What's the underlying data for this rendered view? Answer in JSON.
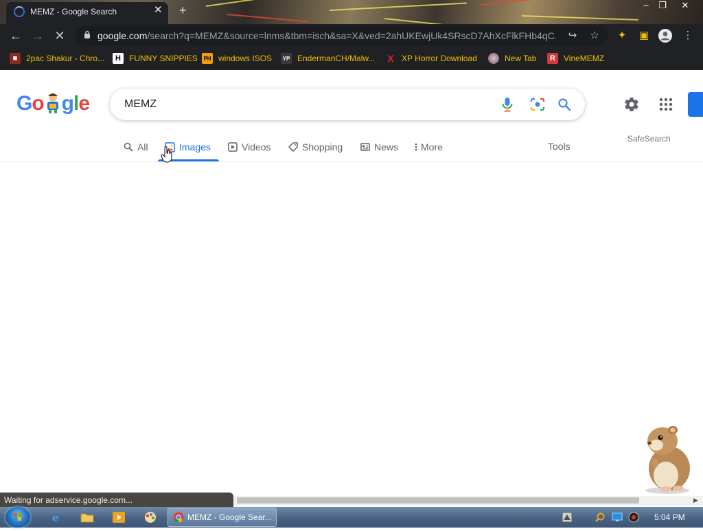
{
  "browser": {
    "tab": {
      "title": "MEMZ - Google Search"
    },
    "url": {
      "host": "google.com",
      "path": "/search?q=MEMZ&source=lnms&tbm=isch&sa=X&ved=2ahUKEwjUk4SRscD7AhXcFlkFHb4qC..."
    },
    "bookmarks": [
      {
        "label": "2pac Shakur - Chro...",
        "icon": "bookmark-icon-2pac",
        "color": "#c0392b",
        "glyph": "■"
      },
      {
        "label": "FUNNY SNIPPIES",
        "icon": "bookmark-icon-h",
        "color": "#ffffff",
        "glyph": "H"
      },
      {
        "label": "windows ISOS",
        "icon": "bookmark-icon-ph",
        "color": "#f0a000",
        "glyph": "PH"
      },
      {
        "label": "EndermanCH/Malw...",
        "icon": "bookmark-icon-yp",
        "color": "#3a3a3a",
        "glyph": "YP"
      },
      {
        "label": "XP Horror Download",
        "icon": "bookmark-icon-x",
        "color": "#e02020",
        "glyph": "X"
      },
      {
        "label": "New Tab",
        "icon": "bookmark-icon-newtab",
        "color": "#b08aa0",
        "glyph": "●"
      },
      {
        "label": "VineMEMZ",
        "icon": "bookmark-icon-r",
        "color": "#d23a3a",
        "glyph": "R"
      }
    ],
    "status": "Waiting for adservice.google.com..."
  },
  "google": {
    "logo_letters": [
      {
        "ch": "G",
        "color": "#4285f4"
      },
      {
        "ch": "o",
        "color": "#ea4335"
      },
      {
        "ch": "",
        "color": "#fbbc05"
      },
      {
        "ch": "g",
        "color": "#4285f4"
      },
      {
        "ch": "l",
        "color": "#34a853"
      },
      {
        "ch": "e",
        "color": "#ea4335"
      }
    ],
    "query": "MEMZ",
    "tabs": [
      {
        "label": "All",
        "icon": "search-icon"
      },
      {
        "label": "Images",
        "icon": "image-icon"
      },
      {
        "label": "Videos",
        "icon": "play-icon"
      },
      {
        "label": "Shopping",
        "icon": "tag-icon"
      },
      {
        "label": "News",
        "icon": "news-icon"
      },
      {
        "label": "More",
        "icon": "more-vert-icon"
      }
    ],
    "tools": "Tools",
    "safesearch": "SafeSearch",
    "accent": "#1a73e8"
  },
  "taskbar": {
    "active_task": "MEMZ - Google Sear...",
    "clock": "5:04 PM"
  }
}
